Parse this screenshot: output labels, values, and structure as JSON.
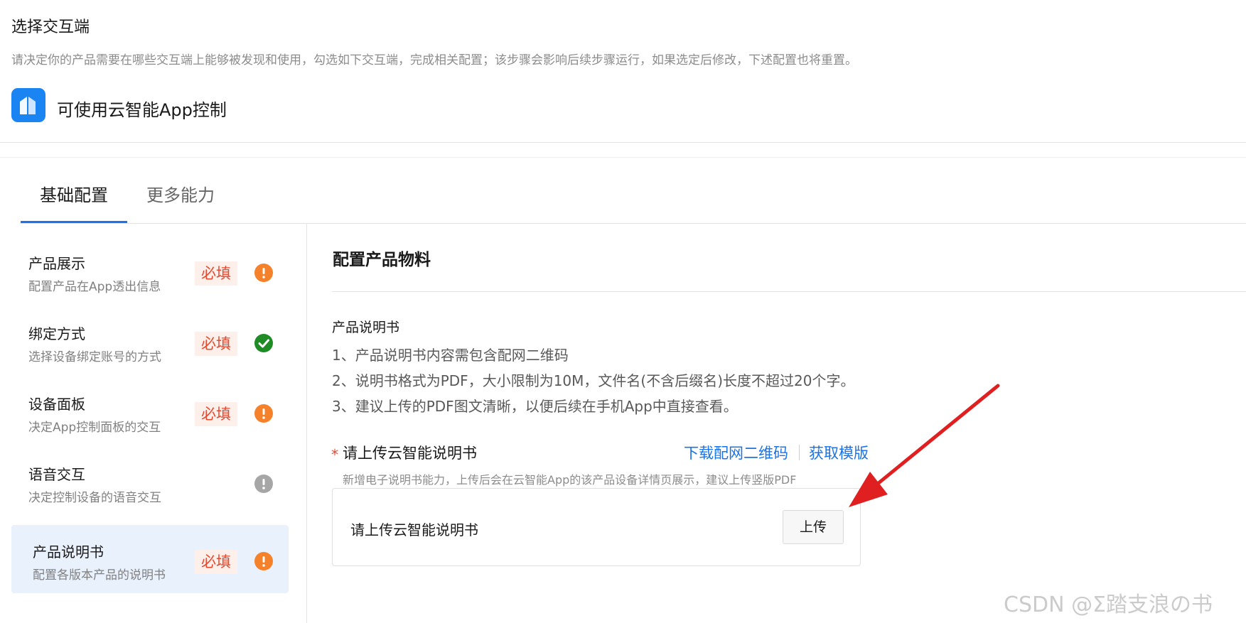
{
  "header": {
    "title": "选择交互端",
    "description": "请决定你的产品需要在哪些交互端上能够被发现和使用，勾选如下交互端，完成相关配置；该步骤会影响后续步骤运行，如果选定后修改，下述配置也将重置。",
    "app_option_label": "可使用云智能App控制",
    "app_icon": "house-app-icon"
  },
  "tabs": [
    {
      "label": "基础配置",
      "active": true
    },
    {
      "label": "更多能力",
      "active": false
    }
  ],
  "sidebar": {
    "items": [
      {
        "title": "产品展示",
        "subtitle": "配置产品在App透出信息",
        "badge": "必填",
        "status": "warning"
      },
      {
        "title": "绑定方式",
        "subtitle": "选择设备绑定账号的方式",
        "badge": "必填",
        "status": "done"
      },
      {
        "title": "设备面板",
        "subtitle": "决定App控制面板的交互",
        "badge": "必填",
        "status": "warning"
      },
      {
        "title": "语音交互",
        "subtitle": "决定控制设备的语音交互",
        "badge": "",
        "status": "optional"
      },
      {
        "title": "产品说明书",
        "subtitle": "配置各版本产品的说明书",
        "badge": "必填",
        "status": "warning",
        "active": true
      }
    ]
  },
  "main": {
    "section_title": "配置产品物料",
    "manual_title": "产品说明书",
    "rules": [
      "1、产品说明书内容需包含配网二维码",
      "2、说明书格式为PDF，大小限制为10M，文件名(不含后缀名)长度不超过20个字。",
      "3、建议上传的PDF图文清晰，以便后续在手机App中直接查看。"
    ],
    "upload": {
      "required_mark": "*",
      "label": "请上传云智能说明书",
      "link_qr": "下载配网二维码",
      "link_template": "获取模版",
      "hint": "新增电子说明书能力，上传后会在云智能App的该产品设备详情页展示，建议上传竖版PDF",
      "box_text": "请上传云智能说明书",
      "button": "上传"
    }
  },
  "watermark": "CSDN @Σ踏支浪の书",
  "colors": {
    "accent": "#1a73e8",
    "required": "#e5482f",
    "warning": "#f5822a",
    "success": "#1e8b24",
    "arrow": "#e02020"
  }
}
